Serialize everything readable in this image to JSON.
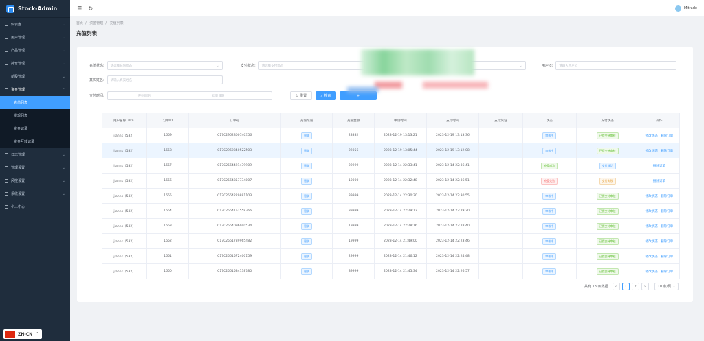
{
  "app": {
    "title": "Stock-Admin"
  },
  "sidebar": {
    "items": [
      {
        "label": "仪表盘",
        "open": false
      },
      {
        "label": "用户管理",
        "open": false
      },
      {
        "label": "产品管理",
        "open": false
      },
      {
        "label": "持仓管理",
        "open": false
      },
      {
        "label": "新股管理",
        "open": false
      },
      {
        "label": "资金管理",
        "open": true
      }
    ],
    "sub_items": [
      {
        "label": "充值列表",
        "active": true
      },
      {
        "label": "提现列表",
        "active": false
      },
      {
        "label": "资金记录",
        "active": false
      },
      {
        "label": "资金互转记录",
        "active": false
      }
    ],
    "items_after": [
      {
        "label": "日志管理"
      },
      {
        "label": "管理设置"
      },
      {
        "label": "风控设置"
      },
      {
        "label": "系统设置"
      },
      {
        "label": "个人中心"
      }
    ],
    "lang": "ZH-CN"
  },
  "topbar": {
    "user": "Mitrade"
  },
  "breadcrumb": [
    "首页",
    "资金管理",
    "充值列表"
  ],
  "page_title": "充值列表",
  "filters": {
    "channel_label": "充值状态:",
    "channel_placeholder": "请选择充值状态",
    "pay_status_label": "支付状态:",
    "pay_status_placeholder": "请选择支付状态",
    "userid_label": "用户id:",
    "userid_placeholder": "请输入用户id",
    "realname_label": "真实姓名:",
    "realname_placeholder": "请输入真实姓名",
    "paytime_label": "支付时间:",
    "start_placeholder": "开始日期",
    "end_placeholder": "结束日期",
    "range_sep": "-",
    "reset_label": "重置",
    "search_label": "搜索"
  },
  "table": {
    "columns": [
      "用户名称（ID）",
      "订单ID",
      "订单号",
      "充值渠道",
      "充值金额",
      "申请时间",
      "支付时间",
      "支付凭证",
      "状态",
      "支付状态",
      "操作"
    ],
    "rows": [
      {
        "user": "jiahns（532）",
        "id": "1659",
        "no": "C1702962800740356",
        "channel": "银联",
        "amount": "23332",
        "apply": "2023-12-19 13:13:21",
        "pay": "2023-12-19 13:13:36",
        "status": "审核中",
        "status_color": "blue",
        "pay_status": "已提交待审核",
        "pay_color": "green",
        "actions": [
          "修改状态",
          "删除订单"
        ],
        "hl": false
      },
      {
        "user": "jiahns（532）",
        "id": "1658",
        "no": "C1702962340522503",
        "channel": "银联",
        "amount": "22056",
        "apply": "2023-12-19 13:05:44",
        "pay": "2023-12-19 13:12:08",
        "status": "审核中",
        "status_color": "blue",
        "pay_status": "已提交待审核",
        "pay_color": "green",
        "actions": [
          "修改状态",
          "删除订单"
        ],
        "hl": true
      },
      {
        "user": "jiahns（532）",
        "id": "1657",
        "no": "C1702564421479909",
        "channel": "银联",
        "amount": "29999",
        "apply": "2023-12-14 22:33:41",
        "pay": "2023-12-14 22:36:41",
        "status": "充值成功",
        "status_color": "green",
        "pay_status": "支付成功",
        "pay_color": "blue",
        "actions": [
          "删除订单"
        ],
        "hl": false
      },
      {
        "user": "jiahns（532）",
        "id": "1656",
        "no": "C1702564357734807",
        "channel": "银联",
        "amount": "10000",
        "apply": "2023-12-14 22:32:48",
        "pay": "2023-12-14 22:36:51",
        "status": "充值失败",
        "status_color": "red",
        "pay_status": "支付失败",
        "pay_color": "orange",
        "actions": [
          "删除订单"
        ],
        "hl": false
      },
      {
        "user": "jiahns（532）",
        "id": "1655",
        "no": "C1702564229881103",
        "channel": "银联",
        "amount": "39999",
        "apply": "2023-12-14 22:30:30",
        "pay": "2023-12-14 22:30:55",
        "status": "审核中",
        "status_color": "blue",
        "pay_status": "已提交待审核",
        "pay_color": "green",
        "actions": [
          "修改状态",
          "删除订单"
        ],
        "hl": false
      },
      {
        "user": "jiahns（532）",
        "id": "1654",
        "no": "C1702564151558766",
        "channel": "银联",
        "amount": "39999",
        "apply": "2023-12-14 22:29:12",
        "pay": "2023-12-14 22:29:20",
        "status": "审核中",
        "status_color": "blue",
        "pay_status": "已提交待审核",
        "pay_color": "green",
        "actions": [
          "修改状态",
          "删除订单"
        ],
        "hl": false
      },
      {
        "user": "jiahns（532）",
        "id": "1653",
        "no": "C1702564096040534",
        "channel": "银联",
        "amount": "19999",
        "apply": "2023-12-14 22:28:16",
        "pay": "2023-12-14 22:28:40",
        "status": "审核中",
        "status_color": "blue",
        "pay_status": "已提交待审核",
        "pay_color": "green",
        "actions": [
          "修改状态",
          "删除订单"
        ],
        "hl": false
      },
      {
        "user": "jiahns（532）",
        "id": "1652",
        "no": "C1702561739965482",
        "channel": "银联",
        "amount": "19999",
        "apply": "2023-12-14 21:49:00",
        "pay": "2023-12-14 22:23:46",
        "status": "审核中",
        "status_color": "blue",
        "pay_status": "已提交待审核",
        "pay_color": "green",
        "actions": [
          "修改状态",
          "删除订单"
        ],
        "hl": false
      },
      {
        "user": "jiahns（532）",
        "id": "1651",
        "no": "C1702561572400159",
        "channel": "银联",
        "amount": "29999",
        "apply": "2023-12-14 21:46:12",
        "pay": "2023-12-14 22:24:48",
        "status": "审核中",
        "status_color": "blue",
        "pay_status": "已提交待审核",
        "pay_color": "green",
        "actions": [
          "修改状态",
          "删除订单"
        ],
        "hl": false
      },
      {
        "user": "jiahns（532）",
        "id": "1650",
        "no": "C1702561534138780",
        "channel": "银联",
        "amount": "39999",
        "apply": "2023-12-14 21:45:34",
        "pay": "2023-12-14 22:26:57",
        "status": "审核中",
        "status_color": "blue",
        "pay_status": "已提交待审核",
        "pay_color": "green",
        "actions": [
          "修改状态",
          "删除订单"
        ],
        "hl": false
      }
    ]
  },
  "pagination": {
    "total": "共有 13 条数据",
    "pages": [
      "1",
      "2"
    ],
    "current": "1",
    "page_size": "10 条/页",
    "prev": "‹",
    "next": "›"
  }
}
